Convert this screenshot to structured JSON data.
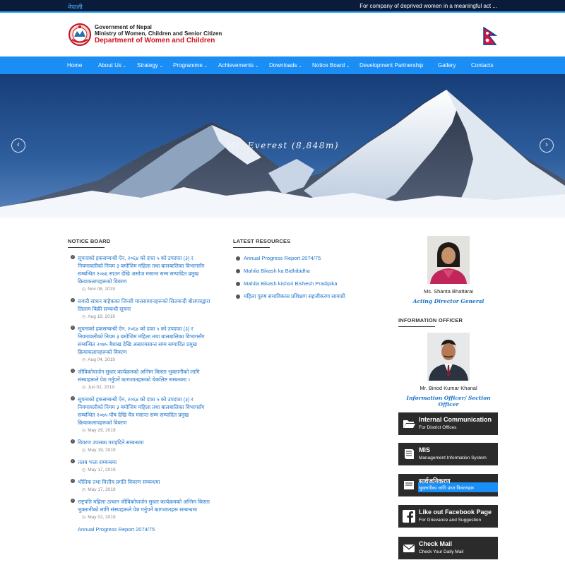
{
  "topbar": {
    "language_link": "नेपाली",
    "ticker": "For company of deprived women in a meaningful act ..."
  },
  "header": {
    "line1": "Government of Nepal",
    "line2": "Ministry of Women, Children and Senior Citizen",
    "line3": "Department of Women and Children",
    "emblem_icon": "nepal-emblem-icon",
    "flag_icon": "nepal-flag-icon"
  },
  "nav": {
    "items": [
      {
        "label": "Home",
        "dropdown": false
      },
      {
        "label": "About Us",
        "dropdown": true
      },
      {
        "label": "Strategy",
        "dropdown": true
      },
      {
        "label": "Programme",
        "dropdown": true
      },
      {
        "label": "Achievements",
        "dropdown": true
      },
      {
        "label": "Downloads",
        "dropdown": true
      },
      {
        "label": "Notice Board",
        "dropdown": true
      },
      {
        "label": "Development Partnership",
        "dropdown": false
      },
      {
        "label": "Gallery",
        "dropdown": false
      },
      {
        "label": "Contacts",
        "dropdown": false
      }
    ],
    "caret": "⌄"
  },
  "hero": {
    "caption": "Mt. Everest (8,848m)",
    "prev_arrow": "‹",
    "next_arrow": "›"
  },
  "notice_board": {
    "heading": "NOTICE BOARD",
    "items": [
      {
        "title": "सूचनाको हकसम्बन्धी ऐन, २०६४ को दफा ५ को उपदफा (३) र नियमावलीको नियम ३ बमोजिम महिला तथा बालबालिका विभागसँग सम्बन्धित २०७६ साउन देखि असोज मसान्त सम्म सम्पादित प्रमुख क्रियाकलापहरूको विवरण",
        "date": "Nov 08, 2019"
      },
      {
        "title": "सवारी साधन बाहेकका जिन्सी मालसामानहरूको सिलबन्दी बोलपत्रद्वारा लिलाम बिक्री सम्बन्धी सूचना",
        "date": "Aug 19, 2019"
      },
      {
        "title": "सूचनाको हकसम्बन्धी ऐन, २०६४ को दफा ५ को उपदफा (३) र नियमावलीको नियम ३ बमोजिम महिला तथा बालबालिका विभागसँग सम्बन्धित २०७५ बैशाख देखि असारमसान्त सम्म सम्पादित प्रमुख क्रियाकलापहरूको विवरण",
        "date": "Aug 04, 2019"
      },
      {
        "title": "जीविकोपार्जन सुधार कार्यक्रमको अन्तिम किस्ता भुक्तानीको लागि संस्थाहरूले पेश गर्नुपर्ने कागजातहरूको चेकलिष्ट सम्बन्धमा ।",
        "date": "Jun 02, 2019"
      },
      {
        "title": "सूचनाको हकसम्बन्धी ऐन, २०६४ को दफा ५ को उपदफा (३) र नियमावलीको नियम ३ बमोजिम महिला तथा बालबालिका विभागसँग सम्बन्धित २०७५ पौष देखि चैत्र मसान्त सम्म सम्पादित प्रमुख क्रियाकलापहरूको विवरण",
        "date": "May 29, 2019"
      },
      {
        "title": "विवरण उपलब्ध गराइदिने सम्बन्धमा",
        "date": "May 19, 2019"
      },
      {
        "title": "तलब भत्ता सम्बन्धमा",
        "date": "May 17, 2019"
      },
      {
        "title": "भौतिक तथा वित्तीय प्रगति विवरण सम्बन्धमा",
        "date": "May 17, 2019"
      },
      {
        "title": "राष्ट्रपति महिला उत्थान जीविकोपार्जन सुधार कार्यक्रमको अन्तिम किस्ता भुक्तानीको लागि संस्थाहरूले पेश गर्नुपर्ने कागजातहरू सम्बन्धमा",
        "date": "May 02, 2019"
      },
      {
        "title": "Annual Progress Report 2074/75",
        "date": ""
      }
    ],
    "clock_icon": "◷"
  },
  "resources": {
    "heading": "LATEST RESOURCES",
    "items": [
      "Annual Progress Report 2074/75",
      "Mahila Bikash ka Bidhibidha",
      "Mahila Bikash kishori Bishesh Pradipika",
      "महिला पुरुष समाविकास प्रशिक्षण सहजीकरण सामाग्री"
    ]
  },
  "director": {
    "name": "Ms. Shanta Bhattarai",
    "role": "Acting Director General"
  },
  "info_officer": {
    "heading": "INFORMATION OFFICER",
    "name": "Mr. Binod Kumar Khanal",
    "role": "Information Officer/ Section Officer"
  },
  "side_buttons": [
    {
      "title": "Internal Communication",
      "subtitle": "For District Offices",
      "icon": "folder-open-icon"
    },
    {
      "title": "MIS",
      "subtitle": "Management Information System",
      "icon": "book-icon"
    },
    {
      "title": "सार्वजनिकरण",
      "subtitle": "भुक्तानीका लागि प्राप्त विवरणहरू",
      "icon": "document-icon"
    },
    {
      "title": "Like out Facebook Page",
      "subtitle": "For Grievance and Suggestion",
      "icon": "facebook-icon"
    },
    {
      "title": "Check Mail",
      "subtitle": "Check Your Daily Mail",
      "icon": "envelope-icon"
    }
  ],
  "colors": {
    "nav_blue": "#1a8ef5",
    "topbar": "#0b1c3a",
    "brand_red": "#d2141f",
    "link_blue": "#1a73c8",
    "button_dark": "#2b2b2b"
  }
}
